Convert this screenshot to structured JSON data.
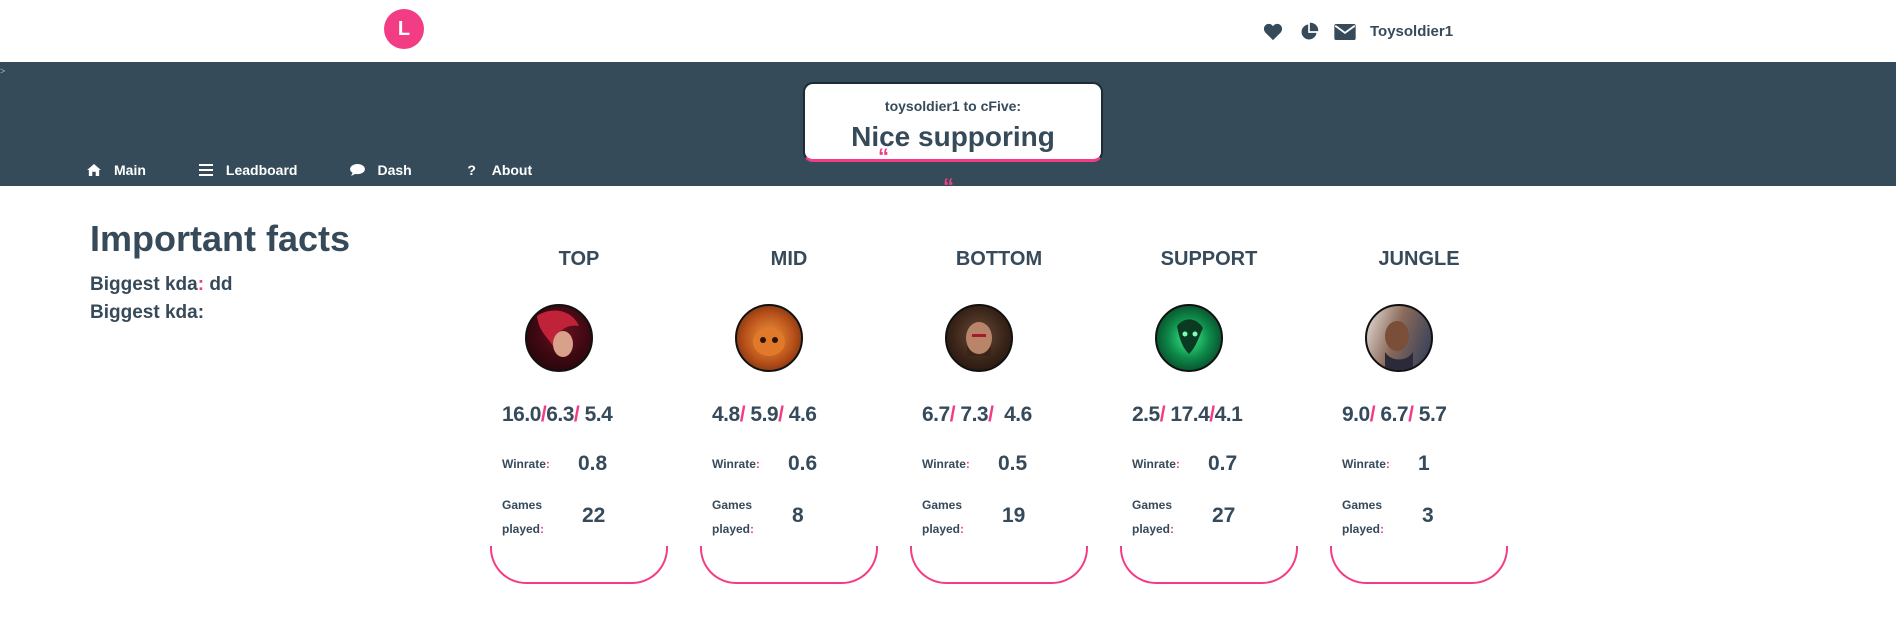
{
  "header": {
    "logo_letter": "L",
    "username": "Toysoldier1",
    "icons": [
      "heart-icon",
      "pie-chart-icon",
      "envelope-icon"
    ]
  },
  "banner": {
    "message": {
      "from": "toysoldier1 to cFive:",
      "text": "Nice supporing"
    },
    "nav": [
      {
        "label": "Main",
        "icon": "home-icon"
      },
      {
        "label": "Leadboard",
        "icon": "list-icon"
      },
      {
        "label": "Dash",
        "icon": "chat-icon"
      },
      {
        "label": "About",
        "icon": "question-icon"
      }
    ]
  },
  "facts": {
    "title": "Important facts",
    "items": [
      {
        "label": "Biggest kda",
        "value": "dd"
      },
      {
        "label": "Biggest kda",
        "value": ""
      }
    ]
  },
  "labels": {
    "winrate": "Winrate",
    "games_played": "Games played"
  },
  "roles": [
    {
      "role": "TOP",
      "k": "16.0",
      "d": "6.3",
      "a": "5.4",
      "winrate": "0.8",
      "games": "22"
    },
    {
      "role": "MID",
      "k": "4.8",
      "d": "5.9",
      "a": "4.6",
      "winrate": "0.6",
      "games": "8"
    },
    {
      "role": "BOTTOM",
      "k": "6.7",
      "d": "7.3",
      "a": "4.6",
      "winrate": "0.5",
      "games": "19"
    },
    {
      "role": "SUPPORT",
      "k": "2.5",
      "d": "17.4",
      "a": "4.1",
      "winrate": "0.7",
      "games": "27"
    },
    {
      "role": "JUNGLE",
      "k": "9.0",
      "d": "6.7",
      "a": "5.7",
      "winrate": "1",
      "games": "3"
    }
  ],
  "colors": {
    "accent": "#f23d84",
    "banner": "#364b5a",
    "text": "#364a5a"
  }
}
